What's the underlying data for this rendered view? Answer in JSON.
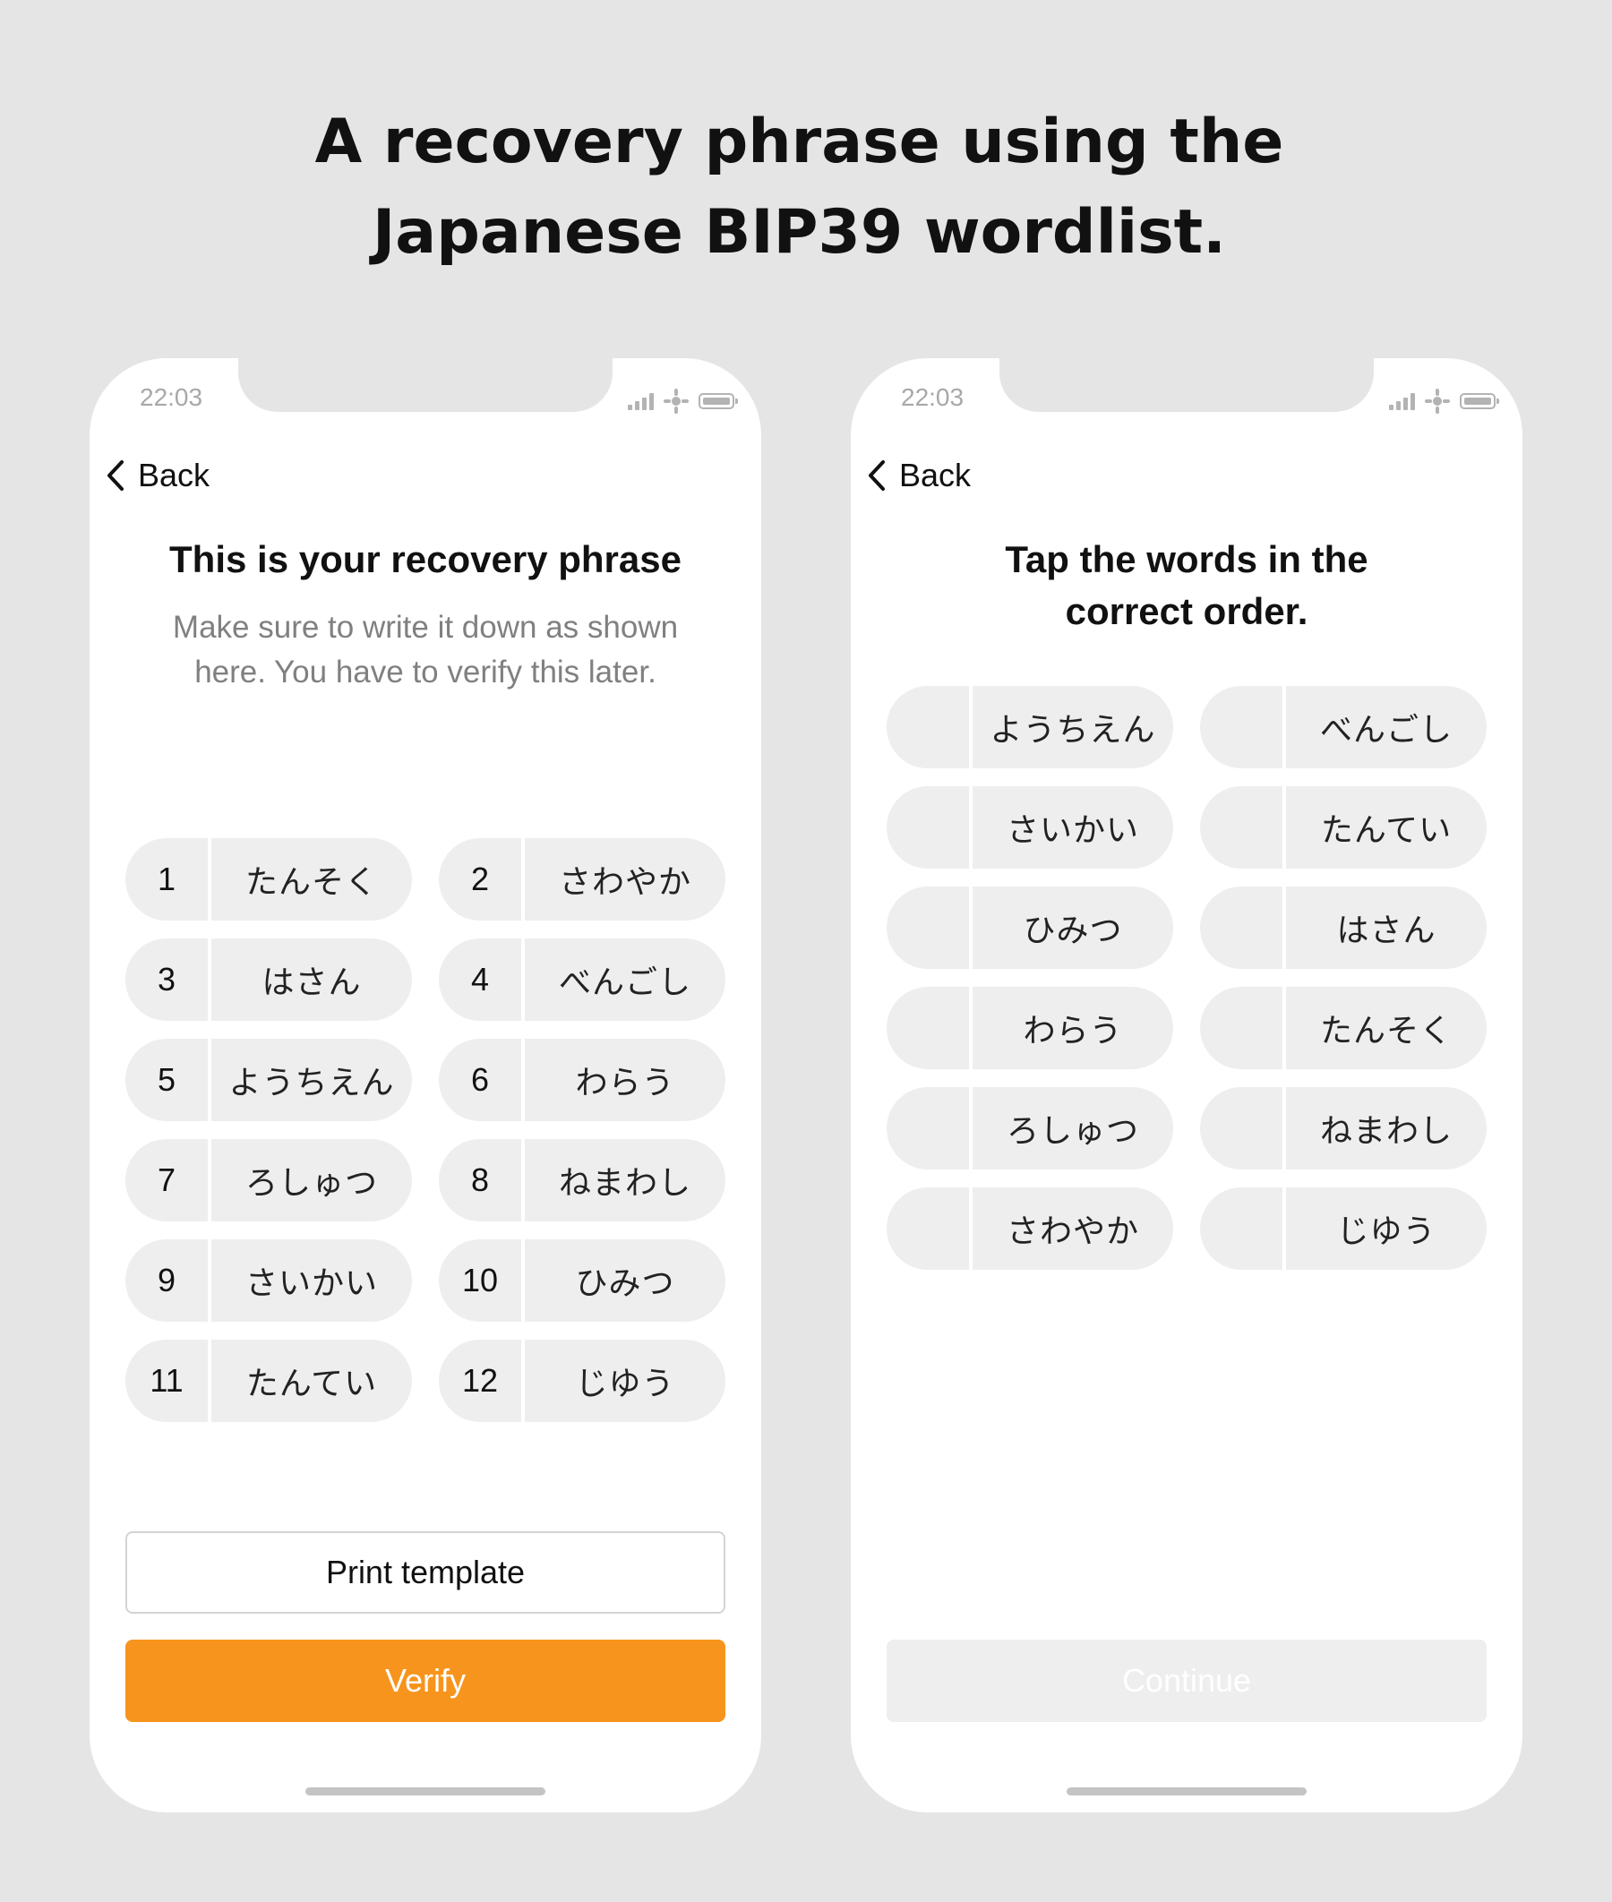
{
  "headline": {
    "line1": "A recovery phrase using the",
    "line2": "Japanese BIP39 wordlist."
  },
  "left_screen": {
    "status_time": "22:03",
    "back_label": "Back",
    "title": "This is your recovery phrase",
    "subtitle_line1": "Make sure to write it down as shown",
    "subtitle_line2": "here. You have to verify this later.",
    "words": [
      {
        "num": "1",
        "word": "たんそく"
      },
      {
        "num": "2",
        "word": "さわやか"
      },
      {
        "num": "3",
        "word": "はさん"
      },
      {
        "num": "4",
        "word": "べんごし"
      },
      {
        "num": "5",
        "word": "ようちえん"
      },
      {
        "num": "6",
        "word": "わらう"
      },
      {
        "num": "7",
        "word": "ろしゅつ"
      },
      {
        "num": "8",
        "word": "ねまわし"
      },
      {
        "num": "9",
        "word": "さいかい"
      },
      {
        "num": "10",
        "word": "ひみつ"
      },
      {
        "num": "11",
        "word": "たんてい"
      },
      {
        "num": "12",
        "word": "じゆう"
      }
    ],
    "print_button": "Print template",
    "verify_button": "Verify"
  },
  "right_screen": {
    "status_time": "22:03",
    "back_label": "Back",
    "title_line1": "Tap the words in the",
    "title_line2": "correct order.",
    "words": [
      {
        "num": "",
        "word": "ようちえん"
      },
      {
        "num": "",
        "word": "べんごし"
      },
      {
        "num": "",
        "word": "さいかい"
      },
      {
        "num": "",
        "word": "たんてい"
      },
      {
        "num": "",
        "word": "ひみつ"
      },
      {
        "num": "",
        "word": "はさん"
      },
      {
        "num": "",
        "word": "わらう"
      },
      {
        "num": "",
        "word": "たんそく"
      },
      {
        "num": "",
        "word": "ろしゅつ"
      },
      {
        "num": "",
        "word": "ねまわし"
      },
      {
        "num": "",
        "word": "さわやか"
      },
      {
        "num": "",
        "word": "じゆう"
      }
    ],
    "continue_button": "Continue"
  },
  "colors": {
    "background": "#e5e5e5",
    "accent": "#f7941d",
    "pill": "#eeeeee",
    "muted_text": "#808080"
  },
  "icons": {
    "back": "chevron-left-icon",
    "signal": "signal-icon",
    "wifi": "wifi-icon",
    "battery": "battery-icon"
  }
}
